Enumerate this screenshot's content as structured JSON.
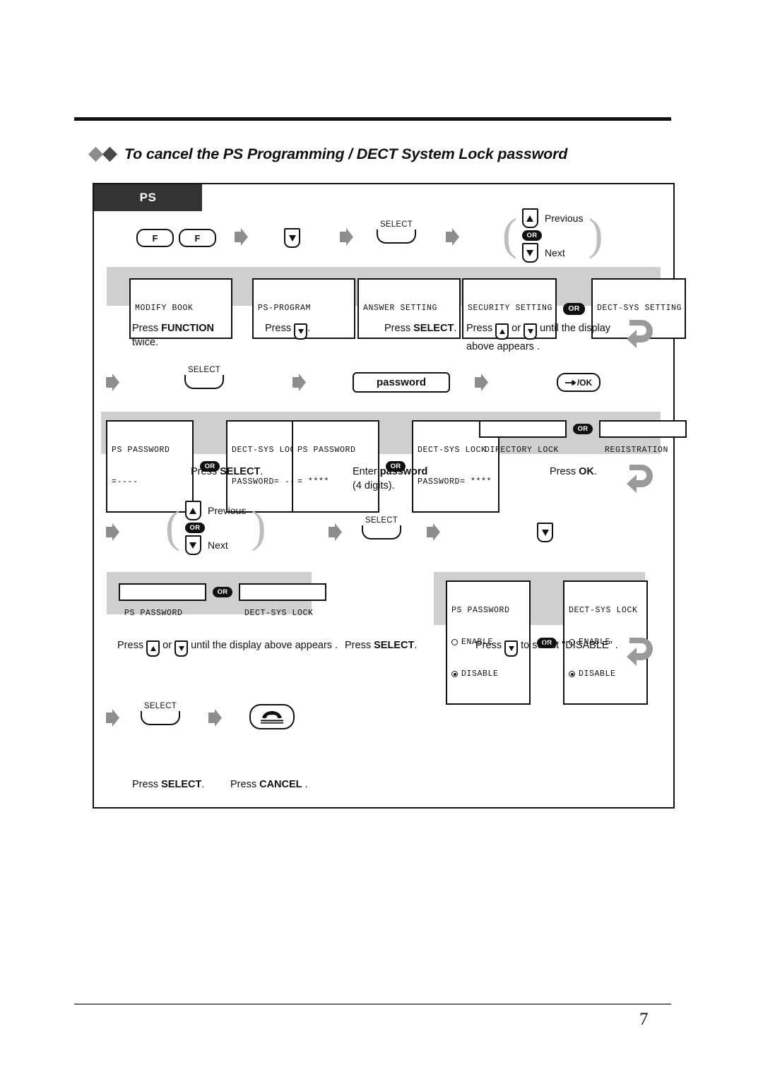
{
  "heading": {
    "title": "To cancel the PS Programming / DECT System Lock password",
    "marker_icon": "double-diamond-icon"
  },
  "panel": {
    "tab_label": "PS"
  },
  "labels": {
    "select": "SELECT",
    "or": "OR",
    "previous": "Previous",
    "next": "Next",
    "f_key": "F",
    "password_button": "password",
    "ok_button": "/OK"
  },
  "steps": [
    {
      "id": "step-1",
      "displays": [
        {
          "lines": [
            "MODIFY BOOK"
          ]
        },
        {
          "lines": [
            "PS-PROGRAM"
          ]
        },
        {
          "lines": [
            "ANSWER SETTING"
          ]
        },
        {
          "lines": [
            "SECURITY SETTING"
          ]
        },
        {
          "lines": [
            "DECT-SYS SETTING"
          ]
        }
      ],
      "instructions": [
        "Press FUNCTION twice.",
        "Press .",
        "Press SELECT.",
        "Press or until the display above appears ."
      ]
    },
    {
      "id": "step-2",
      "displays": [
        {
          "lines": [
            "PS PASSWORD",
            "=----"
          ]
        },
        {
          "lines": [
            "DECT-SYS LOCK",
            "PASSWORD= ----"
          ]
        },
        {
          "lines": [
            "PS PASSWORD",
            "= ****"
          ]
        },
        {
          "lines": [
            "DECT-SYS LOCK",
            "PASSWORD= ****"
          ]
        },
        {
          "lines": [
            "DIRECTORY LOCK"
          ]
        },
        {
          "lines": [
            "REGISTRATION"
          ]
        }
      ],
      "instructions": [
        "Press SELECT.",
        "Enter password (4 digits).",
        "Press OK."
      ]
    },
    {
      "id": "step-3",
      "displays": [
        {
          "lines": [
            "PS PASSWORD"
          ]
        },
        {
          "lines": [
            "DECT-SYS LOCK"
          ]
        },
        {
          "title": "PS PASSWORD",
          "options": [
            {
              "label": "ENABLE",
              "selected": false
            },
            {
              "label": "DISABLE",
              "selected": true
            }
          ]
        },
        {
          "title": "DECT-SYS LOCK",
          "options": [
            {
              "label": "ENABLE",
              "selected": false
            },
            {
              "label": "DISABLE",
              "selected": true
            }
          ]
        }
      ],
      "instructions": [
        "Press or until the display above appears .",
        "Press SELECT.",
        "Press to select \"DISABLE\" ."
      ]
    },
    {
      "id": "step-4",
      "instructions": [
        "Press SELECT.",
        "Press CANCEL ."
      ]
    }
  ],
  "text": {
    "press": "Press",
    "or_word": "or",
    "function_bold": "FUNCTION",
    "twice": "twice.",
    "period": ".",
    "select_bold": "SELECT",
    "enter": "Enter",
    "password_bold": "password",
    "four_digits": "(4 digits).",
    "ok_bold": "OK",
    "cancel_bold": "CANCEL",
    "until_display": "until the display",
    "above_appears": "above appears .",
    "until_display_above_appears": "until the display above appears .",
    "to_select_disable": "to select \"DISABLE\" ."
  },
  "display_rows": {
    "row1": [
      "MODIFY BOOK",
      "PS-PROGRAM",
      "ANSWER SETTING",
      "SECURITY SETTING",
      "DECT-SYS SETTING"
    ],
    "row2_a": [
      "PS PASSWORD",
      "=----"
    ],
    "row2_b": [
      "DECT-SYS LOCK",
      "PASSWORD= ----"
    ],
    "row2_c": [
      "PS PASSWORD",
      "= ****"
    ],
    "row2_d": [
      "DECT-SYS LOCK",
      "PASSWORD= ****"
    ],
    "row2_e": "DIRECTORY LOCK",
    "row2_f": "REGISTRATION",
    "row3_a": "PS PASSWORD",
    "row3_b": "DECT-SYS LOCK",
    "row3_c_title": "PS PASSWORD",
    "row3_d_title": "DECT-SYS LOCK",
    "enable": "ENABLE",
    "disable": "DISABLE"
  },
  "footer": {
    "page_number": "7"
  },
  "colors": {
    "tab_background": "#333333",
    "band_background": "#cfcfcf",
    "arrow_gray": "#8d8d8d",
    "ink": "#111111"
  }
}
